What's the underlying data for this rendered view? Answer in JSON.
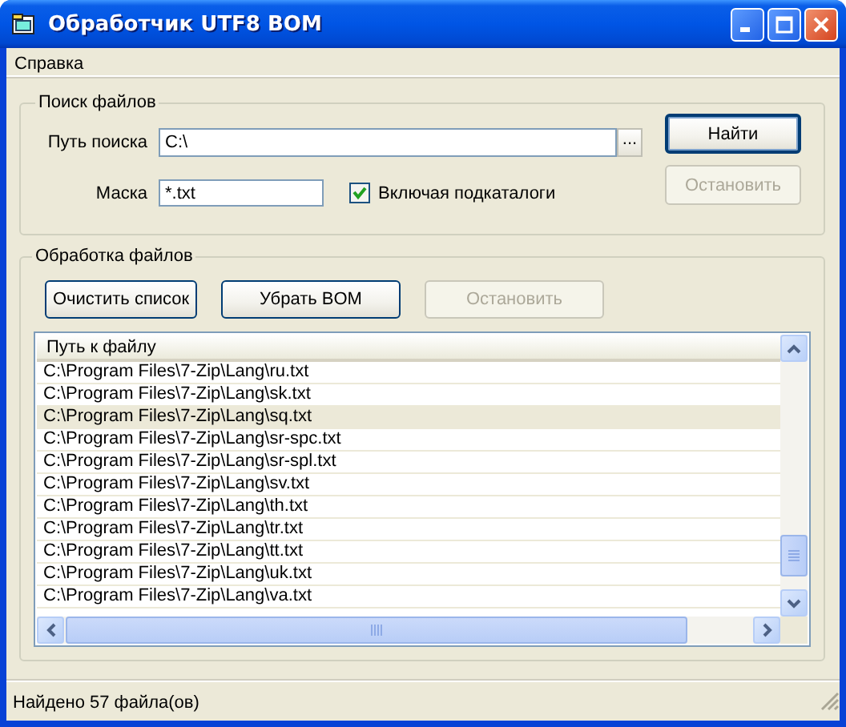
{
  "window": {
    "title": "Обработчик UTF8 BOM"
  },
  "menu": [
    {
      "label": "Справка"
    }
  ],
  "search_group": {
    "title": "Поиск файлов",
    "path_label": "Путь поиска",
    "path_value": "C:\\",
    "browse_button": "...",
    "mask_label": "Маска",
    "mask_value": "*.txt",
    "subfolders": {
      "label": "Включая подкаталоги",
      "checked": true
    },
    "buttons": [
      {
        "label": "Найти",
        "disabled": false,
        "default": true
      },
      {
        "label": "Остановить",
        "disabled": true,
        "default": false
      }
    ]
  },
  "process_group": {
    "title": "Обработка файлов",
    "buttons": [
      {
        "label": "Очистить список",
        "disabled": false
      },
      {
        "label": "Убрать BOM",
        "disabled": false
      },
      {
        "label": "Остановить",
        "disabled": true
      }
    ],
    "list": {
      "columns": [
        "Путь к файлу"
      ],
      "rows": [
        {
          "path": "C:\\Program Files\\7-Zip\\Lang\\ru.txt",
          "selected": false
        },
        {
          "path": "C:\\Program Files\\7-Zip\\Lang\\sk.txt",
          "selected": false
        },
        {
          "path": "C:\\Program Files\\7-Zip\\Lang\\sq.txt",
          "selected": true
        },
        {
          "path": "C:\\Program Files\\7-Zip\\Lang\\sr-spc.txt",
          "selected": false
        },
        {
          "path": "C:\\Program Files\\7-Zip\\Lang\\sr-spl.txt",
          "selected": false
        },
        {
          "path": "C:\\Program Files\\7-Zip\\Lang\\sv.txt",
          "selected": false
        },
        {
          "path": "C:\\Program Files\\7-Zip\\Lang\\th.txt",
          "selected": false
        },
        {
          "path": "C:\\Program Files\\7-Zip\\Lang\\tr.txt",
          "selected": false
        },
        {
          "path": "C:\\Program Files\\7-Zip\\Lang\\tt.txt",
          "selected": false
        },
        {
          "path": "C:\\Program Files\\7-Zip\\Lang\\uk.txt",
          "selected": false
        },
        {
          "path": "C:\\Program Files\\7-Zip\\Lang\\va.txt",
          "selected": false
        }
      ]
    }
  },
  "status_bar": {
    "text": "Найдено 57 файла(ов)"
  }
}
